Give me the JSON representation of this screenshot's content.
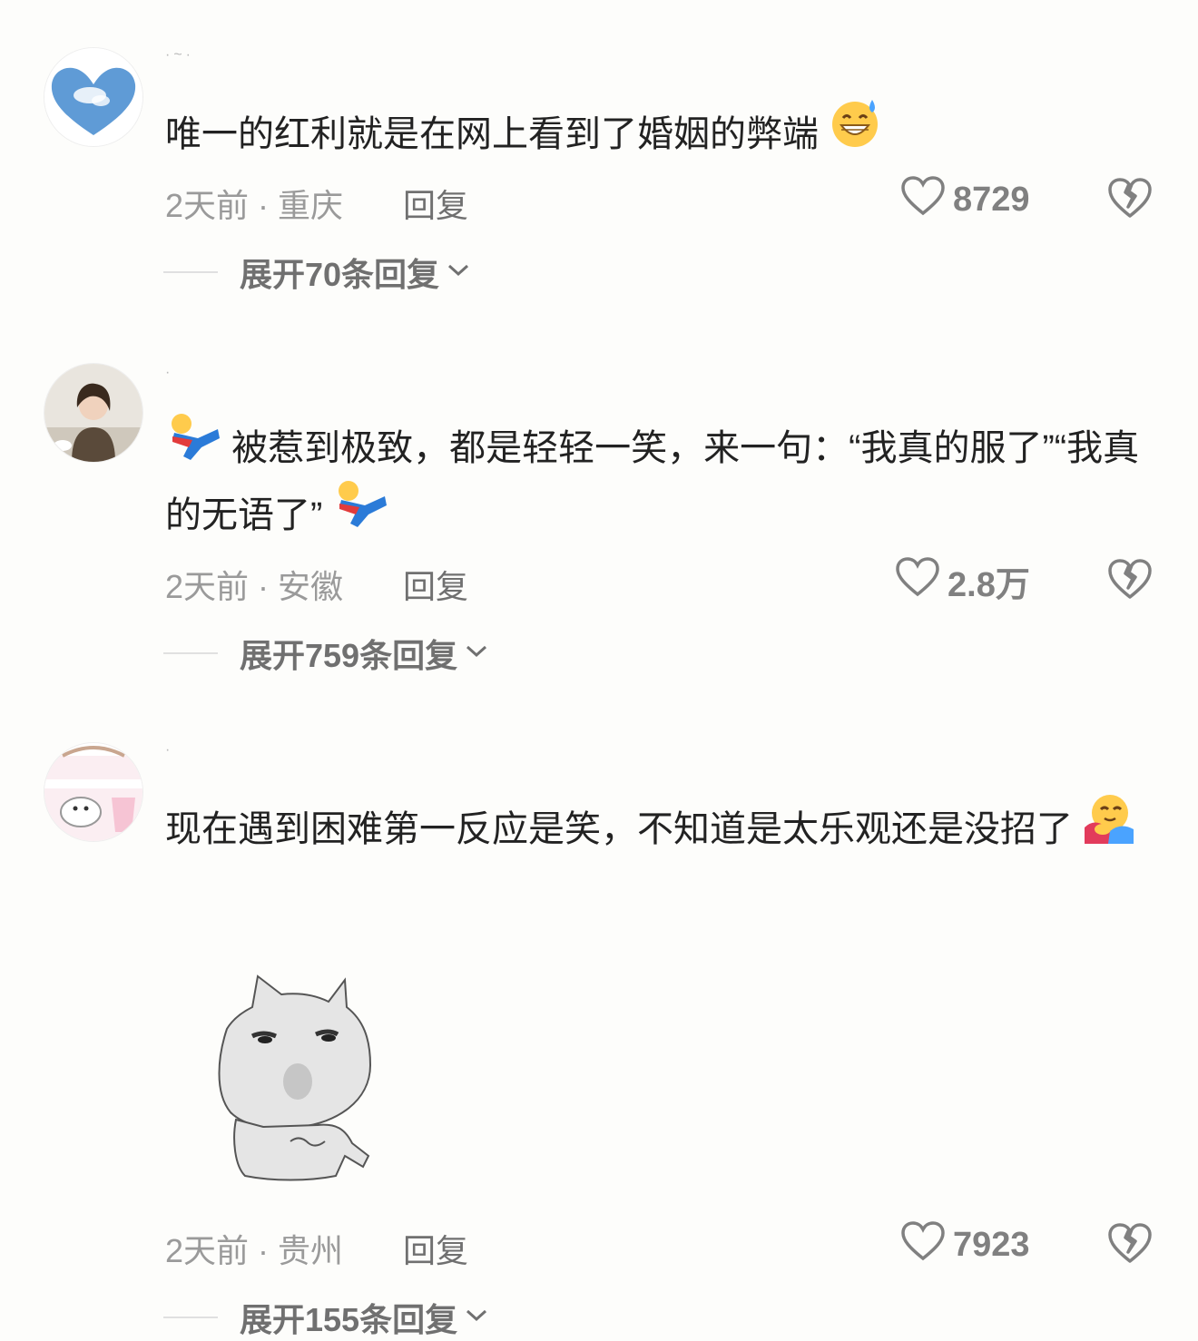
{
  "comments": [
    {
      "username": "·~·",
      "text": "唯一的红利就是在网上看到了婚姻的弊端",
      "time_location": "2天前 · 重庆",
      "reply_label": "回复",
      "likes": "8729",
      "expand_label": "展开70条回复",
      "emoji_end": "grinning-sweat-face-icon"
    },
    {
      "username": "·",
      "text": "被惹到极致，都是轻轻一笑，来一句：“我真的服了”“我真的无语了”",
      "time_location": "2天前 · 安徽",
      "reply_label": "回复",
      "likes": "2.8万",
      "expand_label": "展开759条回复",
      "emoji_start": "lying-down-person-icon",
      "emoji_end": "lying-down-person-icon"
    },
    {
      "username": "·",
      "text": "现在遇到困难第一反应是笑，不知道是太乐观还是没招了",
      "time_location": "2天前 · 贵州",
      "reply_label": "回复",
      "likes": "7923",
      "expand_label": "展开155条回复",
      "emoji_end": "hugging-face-icon",
      "sticker": "cat-meme-sticker"
    }
  ],
  "colors": {
    "background": "#fdfdfb",
    "text": "#222222",
    "meta": "#9a9a9a",
    "action": "#707070"
  }
}
